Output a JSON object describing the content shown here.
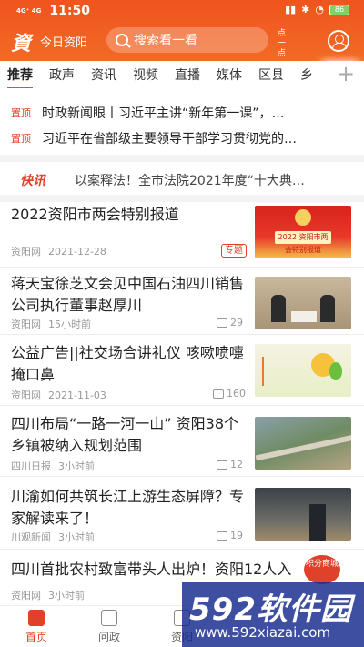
{
  "status_bar": {
    "network": "4G⁺ 4G",
    "time": "11:50",
    "battery": "86"
  },
  "header": {
    "app_name": "今日资阳",
    "search_placeholder": "搜索看一看",
    "scan_label": "点一点",
    "logo_text": "資"
  },
  "tabs": [
    "推荐",
    "政声",
    "资讯",
    "视频",
    "直播",
    "媒体",
    "区县",
    "乡"
  ],
  "pinned": [
    {
      "badge": "置顶",
      "title": "时政新闻眼丨习近平主讲“新年第一课”，…"
    },
    {
      "badge": "置顶",
      "title": "习近平在省部级主要领导干部学习贯彻党的…"
    }
  ],
  "flash": {
    "tag": "快讯",
    "text": "以案释法！全市法院2021年度“十大典…"
  },
  "news": [
    {
      "title": "2022资阳市两会特别报道",
      "source": "资阳网",
      "time": "2021-12-28",
      "badge": "专题",
      "thumb_caption": "2022 资阳市两会特别报道"
    },
    {
      "title": "蒋天宝徐芝文会见中国石油四川销售公司执行董事赵厚川",
      "source": "资阳网",
      "time": "15小时前",
      "comments": "29"
    },
    {
      "title": "公益广告||社交场合讲礼仪 咳嗽喷嚏掩口鼻",
      "source": "资阳网",
      "time": "2021-11-03",
      "comments": "160"
    },
    {
      "title": "四川布局“一路一河一山” 资阳38个乡镇被纳入规划范围",
      "source": "四川日报",
      "time": "3小时前",
      "comments": "12"
    },
    {
      "title": "川渝如何共筑长江上游生态屏障？专家解读来了！",
      "source": "川观新闻",
      "time": "3小时前",
      "comments": "19"
    },
    {
      "title": "四川首批农村致富带头人出炉！资阳12人入",
      "source": "资阳网",
      "time": "3小时前"
    }
  ],
  "points_badge": "积分商城",
  "bottom_nav": [
    "首页",
    "问政",
    "资阳"
  ],
  "watermark": {
    "main": "592软件园",
    "sub": "www.592xiazai.com"
  },
  "colors": {
    "brand": "#f0541f",
    "accent": "#e0412b"
  }
}
